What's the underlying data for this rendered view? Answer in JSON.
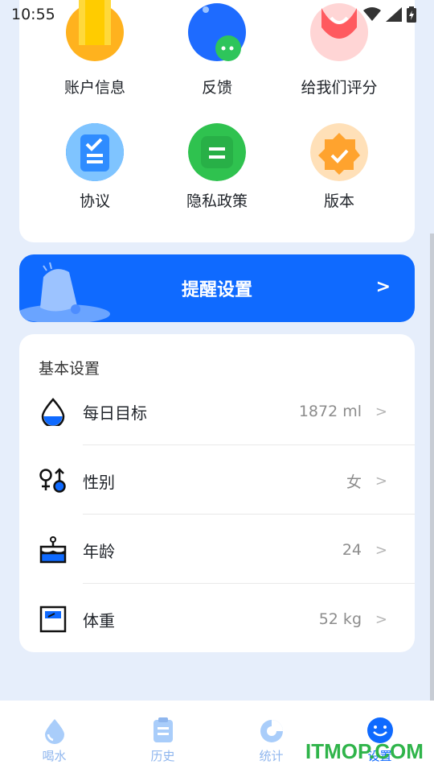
{
  "status_bar": {
    "time": "10:55"
  },
  "grid": {
    "items": [
      {
        "label": "账户信息",
        "icon": "account-info-icon"
      },
      {
        "label": "反馈",
        "icon": "feedback-icon"
      },
      {
        "label": "给我们评分",
        "icon": "rate-us-icon"
      },
      {
        "label": "协议",
        "icon": "agreement-icon"
      },
      {
        "label": "隐私政策",
        "icon": "privacy-policy-icon"
      },
      {
        "label": "版本",
        "icon": "version-icon"
      }
    ]
  },
  "banner": {
    "title": "提醒设置",
    "chevron": ">"
  },
  "settings": {
    "title": "基本设置",
    "rows": [
      {
        "label": "每日目标",
        "value": "1872 ml",
        "icon": "water-drop-icon"
      },
      {
        "label": "性别",
        "value": "女",
        "icon": "gender-icon"
      },
      {
        "label": "年龄",
        "value": "24",
        "icon": "cake-icon"
      },
      {
        "label": "体重",
        "value": "52 kg",
        "icon": "scale-icon"
      }
    ],
    "chevron": ">"
  },
  "tabbar": {
    "tabs": [
      {
        "label": "喝水",
        "icon": "water-tab-icon"
      },
      {
        "label": "历史",
        "icon": "history-tab-icon"
      },
      {
        "label": "统计",
        "icon": "stats-tab-icon"
      },
      {
        "label": "设置",
        "icon": "settings-tab-icon"
      }
    ]
  },
  "watermark": "ITMOP.COM",
  "colors": {
    "primary": "#0f6aff",
    "background": "#e6eefb",
    "tab_inactive": "#8fb6ee"
  }
}
